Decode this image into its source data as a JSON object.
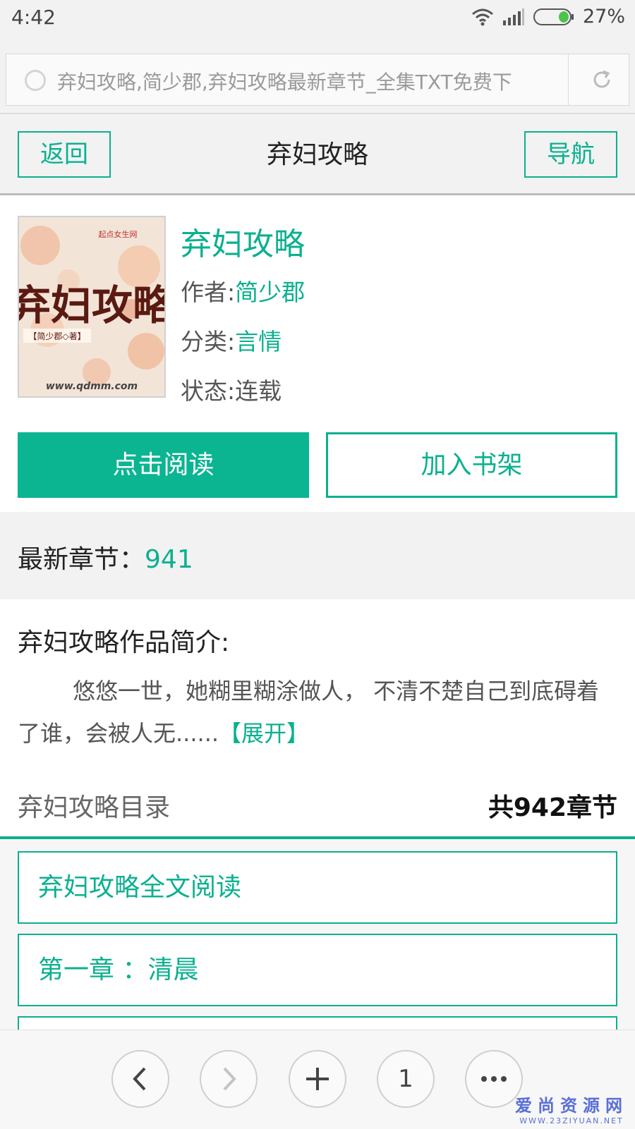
{
  "status": {
    "time": "4:42",
    "battery_pct": "27%"
  },
  "url_bar": {
    "text": "弃妇攻略,简少郡,弃妇攻略最新章节_全集TXT免费下"
  },
  "header": {
    "back_label": "返回",
    "title": "弃妇攻略",
    "nav_label": "导航"
  },
  "book": {
    "title": "弃妇攻略",
    "author_label": "作者:",
    "author": "简少郡",
    "category_label": "分类:",
    "category": "言情",
    "status_label": "状态:",
    "status": "连载",
    "cover": {
      "title": "弃妇攻略",
      "author_tag": "【简少郡◇著】",
      "site": "www.qdmm.com",
      "logo_text": "起点女生网"
    }
  },
  "actions": {
    "read_label": "点击阅读",
    "shelf_label": "加入书架"
  },
  "latest": {
    "label": "最新章节：",
    "value": "941"
  },
  "intro": {
    "heading": "弃妇攻略作品简介:",
    "text": "悠悠一世，她糊里糊涂做人， 不清不楚自己到底碍着了谁，会被人无......",
    "expand_label": "【展开】"
  },
  "directory": {
    "heading": "弃妇攻略目录",
    "count": "共942章节",
    "chapters": [
      {
        "label": "弃妇攻略全文阅读"
      },
      {
        "label": "第一章 ：清晨"
      }
    ]
  },
  "browser": {
    "tab_count": "1"
  },
  "watermark": {
    "line1": "爱尚资源网",
    "line2": "WWW.23ZIYUAN.NET"
  },
  "colors": {
    "accent": "#0bb08f",
    "status_bg": "#f2f2f2"
  }
}
